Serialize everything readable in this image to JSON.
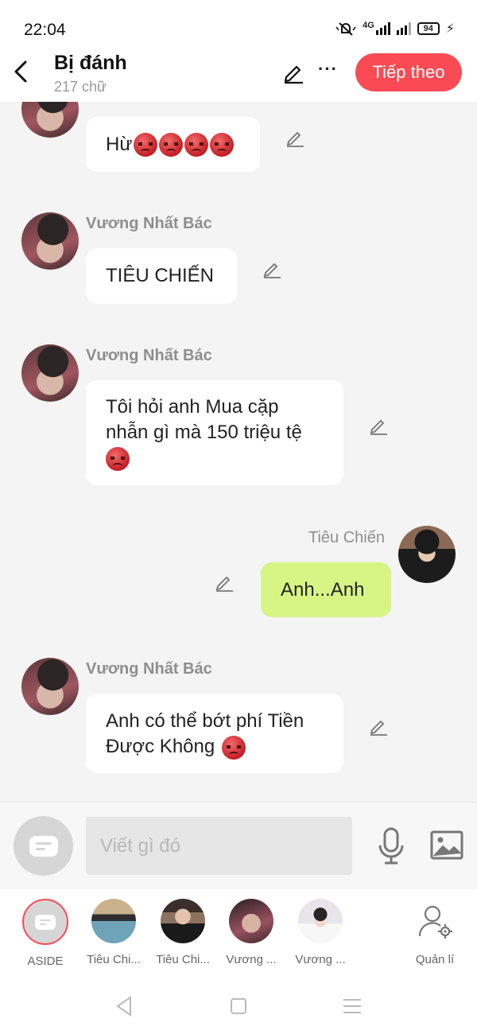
{
  "status_bar": {
    "time": "22:04",
    "network": "4G",
    "battery": "94"
  },
  "header": {
    "title": "Bị đánh",
    "subtitle": "217 chữ",
    "next_label": "Tiếp theo"
  },
  "messages": [
    {
      "sender": "",
      "text": "Hừ",
      "emoji_count": 4,
      "mine": false
    },
    {
      "sender": "Vương Nhất Bác",
      "text": "TIÊU CHIẾN",
      "emoji_count": 0,
      "mine": false
    },
    {
      "sender": "Vương Nhất Bác",
      "line1": "Tôi hỏi anh Mua cặp",
      "line2": "nhẫn gì mà 150 triệu tệ",
      "emoji_count": 1,
      "mine": false
    },
    {
      "sender": "Tiêu Chiến",
      "text": "Anh...Anh",
      "emoji_count": 0,
      "mine": true
    },
    {
      "sender": "Vương Nhất Bác",
      "line1": "Anh có thể bớt phí Tiền",
      "line2": "Được Không",
      "emoji_count": 1,
      "mine": false
    }
  ],
  "input": {
    "placeholder": "Viết gì đó"
  },
  "roles": [
    {
      "label": "ASIDE"
    },
    {
      "label": "Tiêu Chi..."
    },
    {
      "label": "Tiêu Chi..."
    },
    {
      "label": "Vương ..."
    },
    {
      "label": "Vương ..."
    },
    {
      "label": "Quản lí"
    }
  ],
  "colors": {
    "accent": "#fa4b54",
    "my_bubble": "#d7f585",
    "other_bubble": "#ffffff",
    "chat_bg": "#f4f4f4"
  },
  "icons": [
    "back-icon",
    "edit-icon",
    "more-icon",
    "pencil-icon",
    "aside-icon",
    "mic-icon",
    "image-icon",
    "manage-icon",
    "nav-back-icon",
    "nav-home-icon",
    "nav-menu-icon",
    "angry-emoji"
  ]
}
